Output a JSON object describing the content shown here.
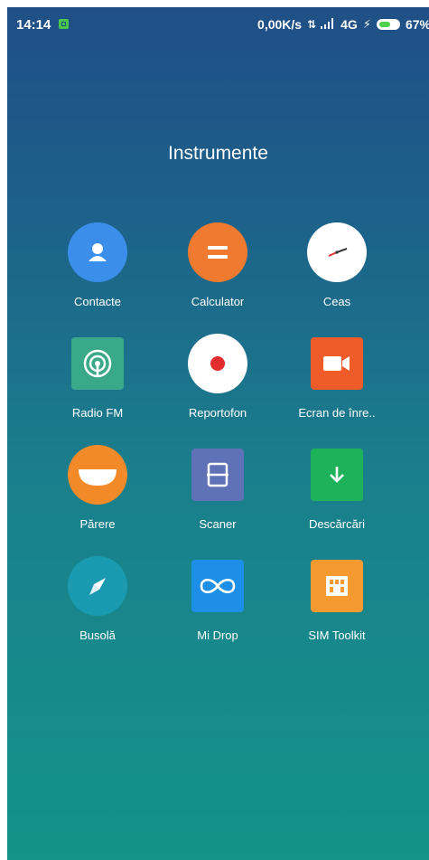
{
  "status_bar": {
    "time": "14:14",
    "network_speed": "0,00K/s",
    "network_type": "4G",
    "battery_percent": "67%",
    "icons": [
      "notification-icon",
      "data-transfer-icon",
      "signal-icon",
      "charging-bolt-icon",
      "battery-icon"
    ]
  },
  "folder": {
    "title": "Instrumente"
  },
  "apps": [
    {
      "label": "Contacte",
      "icon": "contacts-icon",
      "color": "#3b8fea"
    },
    {
      "label": "Calculator",
      "icon": "calculator-icon",
      "color": "#f07a2f"
    },
    {
      "label": "Ceas",
      "icon": "clock-icon",
      "color": "#ffffff"
    },
    {
      "label": "Radio FM",
      "icon": "radio-icon",
      "color": "#3aa98a"
    },
    {
      "label": "Reportofon",
      "icon": "recorder-icon",
      "color": "#ffffff"
    },
    {
      "label": "Ecran de înre..",
      "icon": "screen-recorder-icon",
      "color": "#f05b2a"
    },
    {
      "label": "Părere",
      "icon": "feedback-icon",
      "color": "#f28a2a"
    },
    {
      "label": "Scaner",
      "icon": "scanner-icon",
      "color": "#5f71b7"
    },
    {
      "label": "Descărcări",
      "icon": "downloads-icon",
      "color": "#1eb25a"
    },
    {
      "label": "Busolă",
      "icon": "compass-icon",
      "color": "#1a9ab0"
    },
    {
      "label": "Mi Drop",
      "icon": "mi-drop-icon",
      "color": "#1d8fe6"
    },
    {
      "label": "SIM Toolkit",
      "icon": "sim-toolkit-icon",
      "color": "#f49a30"
    }
  ]
}
